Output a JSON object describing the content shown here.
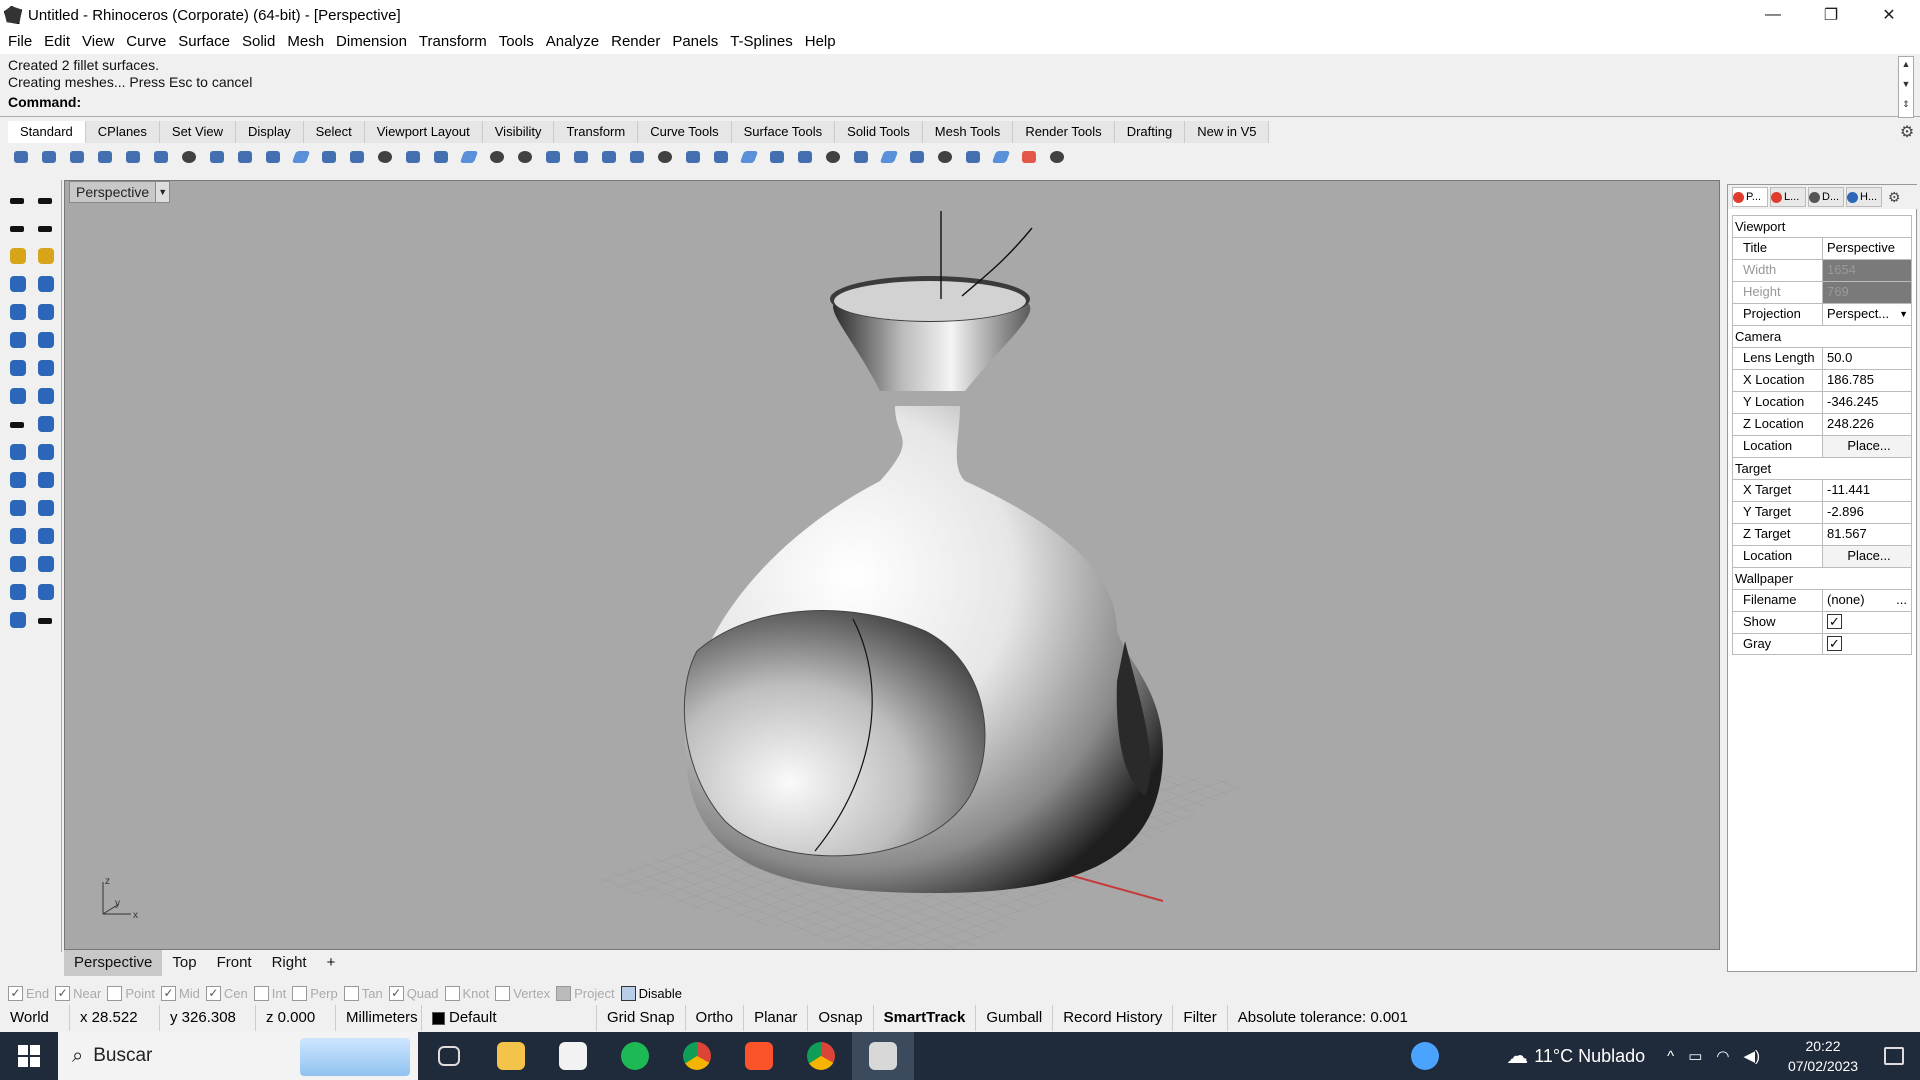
{
  "window": {
    "title": "Untitled - Rhinoceros (Corporate) (64-bit) - [Perspective]",
    "minimize": "—",
    "restore": "❐",
    "close": "✕"
  },
  "menu": [
    "File",
    "Edit",
    "View",
    "Curve",
    "Surface",
    "Solid",
    "Mesh",
    "Dimension",
    "Transform",
    "Tools",
    "Analyze",
    "Render",
    "Panels",
    "T-Splines",
    "Help"
  ],
  "command": {
    "history": [
      "Created 2 fillet surfaces.",
      "Creating meshes... Press Esc to cancel"
    ],
    "prompt": "Command:"
  },
  "toolbar_tabs": [
    "Standard",
    "CPlanes",
    "Set View",
    "Display",
    "Select",
    "Viewport Layout",
    "Visibility",
    "Transform",
    "Curve Tools",
    "Surface Tools",
    "Solid Tools",
    "Mesh Tools",
    "Render Tools",
    "Drafting",
    "New in V5"
  ],
  "viewport": {
    "label": "Perspective",
    "axis_z": "z",
    "axis_y": "y",
    "axis_x": "x"
  },
  "viewport_tabs": [
    "Perspective",
    "Top",
    "Front",
    "Right",
    "+"
  ],
  "panel": {
    "tabs": [
      "P...",
      "L...",
      "D...",
      "H..."
    ],
    "viewport_section": "Viewport",
    "title_label": "Title",
    "title_value": "Perspective",
    "width_label": "Width",
    "width_value": "1654",
    "height_label": "Height",
    "height_value": "769",
    "projection_label": "Projection",
    "projection_value": "Perspect...",
    "camera_section": "Camera",
    "lens_label": "Lens Length",
    "lens_value": "50.0",
    "xloc_label": "X Location",
    "xloc_value": "186.785",
    "yloc_label": "Y Location",
    "yloc_value": "-346.245",
    "zloc_label": "Z Location",
    "zloc_value": "248.226",
    "location_label": "Location",
    "place_label": "Place...",
    "target_section": "Target",
    "xt_label": "X Target",
    "xt_value": "-11.441",
    "yt_label": "Y Target",
    "yt_value": "-2.896",
    "zt_label": "Z Target",
    "zt_value": "81.567",
    "wallpaper_section": "Wallpaper",
    "filename_label": "Filename",
    "filename_value": "(none)",
    "show_label": "Show",
    "gray_label": "Gray"
  },
  "osnaps": [
    "End",
    "Near",
    "Point",
    "Mid",
    "Cen",
    "Int",
    "Perp",
    "Tan",
    "Quad",
    "Knot",
    "Vertex",
    "Project",
    "Disable"
  ],
  "status": {
    "cplane": "World",
    "x": "x 28.522",
    "y": "y 326.308",
    "z": "z 0.000",
    "units": "Millimeters",
    "layer": "Default",
    "grid_snap": "Grid Snap",
    "ortho": "Ortho",
    "planar": "Planar",
    "osnap": "Osnap",
    "smarttrack": "SmartTrack",
    "gumball": "Gumball",
    "record_history": "Record History",
    "filter": "Filter",
    "tolerance": "Absolute tolerance: 0.001"
  },
  "taskbar": {
    "search": "Buscar",
    "weather": "11°C  Nublado",
    "time": "20:22",
    "date": "07/02/2023"
  }
}
